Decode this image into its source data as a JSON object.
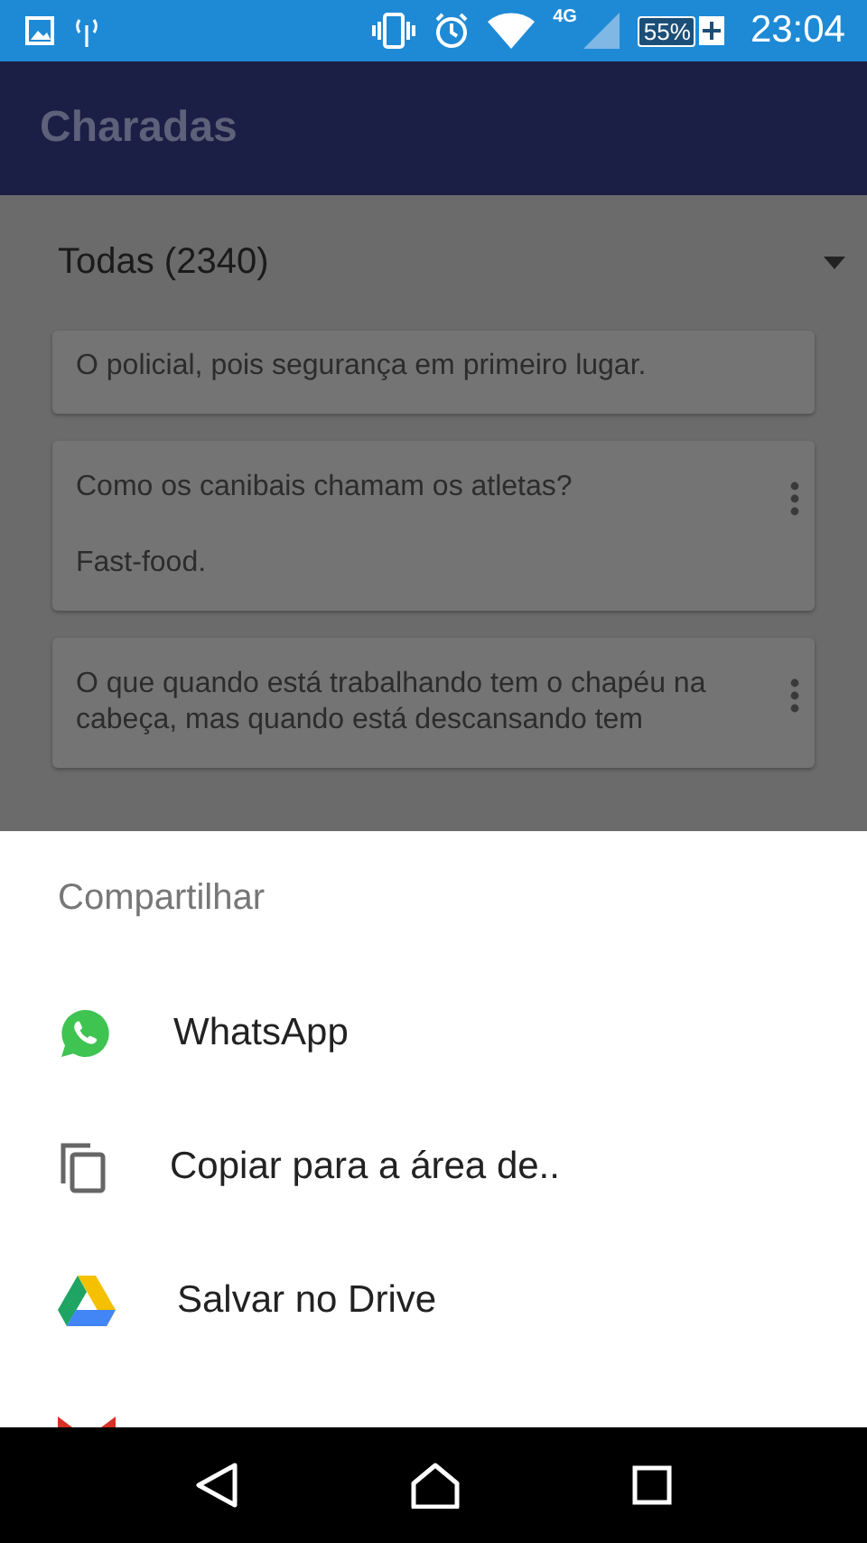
{
  "status_bar": {
    "network": "4G",
    "battery": "55%",
    "time": "23:04"
  },
  "app_bar": {
    "title": "Charadas"
  },
  "filter": {
    "value": "Todas (2340)"
  },
  "cards": [
    {
      "answer": "O policial, pois segurança em primeiro lugar.",
      "menu": false
    },
    {
      "question": "Como os canibais chamam os atletas?",
      "answer": "Fast-food.",
      "menu": true
    },
    {
      "question": "O que quando está trabalhando tem o chapéu na cabeça, mas quando está descansando tem",
      "menu": true
    }
  ],
  "share_sheet": {
    "title": "Compartilhar",
    "items": [
      {
        "kind": "whatsapp",
        "label": "WhatsApp"
      },
      {
        "kind": "copy",
        "label": "Copiar para a área de.."
      },
      {
        "kind": "drive",
        "label": "Salvar no Drive"
      },
      {
        "kind": "gmail"
      }
    ]
  }
}
